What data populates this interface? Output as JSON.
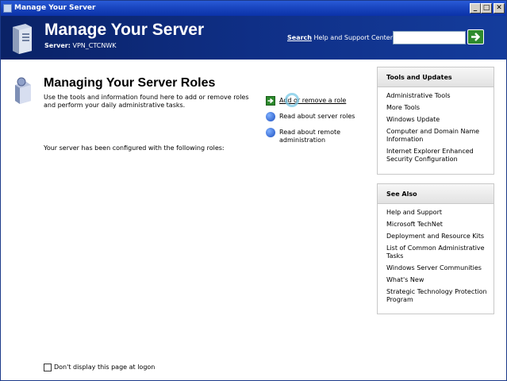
{
  "window": {
    "title": "Manage Your Server",
    "min_glyph": "_",
    "max_glyph": "□",
    "close_glyph": "✕"
  },
  "header": {
    "title": "Manage Your Server",
    "server_label": "Server:",
    "server_name": "VPN_CTCNWK",
    "search_label_bold": "Search",
    "search_label_rest": " Help and Support Center",
    "search_value": ""
  },
  "main": {
    "title": "Managing Your Server Roles",
    "description": "Use the tools and information found here to add or remove roles and perform your daily administrative tasks.",
    "configured_text": "Your server has been configured with the following roles:",
    "links": [
      {
        "label": "Add or remove a role",
        "icon": "green-arrow-icon"
      },
      {
        "label": "Read about server roles",
        "icon": "help-icon"
      },
      {
        "label": "Read about remote administration",
        "icon": "help-icon"
      }
    ]
  },
  "tools_panel": {
    "title": "Tools and Updates",
    "items": [
      "Administrative Tools",
      "More Tools",
      "Windows Update",
      "Computer and Domain Name Information",
      "Internet Explorer Enhanced Security Configuration"
    ]
  },
  "see_also_panel": {
    "title": "See Also",
    "items": [
      "Help and Support",
      "Microsoft TechNet",
      "Deployment and Resource Kits",
      "List of Common Administrative Tasks",
      "Windows Server Communities",
      "What's New",
      "Strategic Technology Protection Program"
    ]
  },
  "footer": {
    "checkbox_label": "Don't display this page at logon",
    "checked": false
  },
  "colors": {
    "header_bg": "#0f2f86",
    "titlebar": "#1b48c2",
    "go_button": "#2e8b2e"
  }
}
